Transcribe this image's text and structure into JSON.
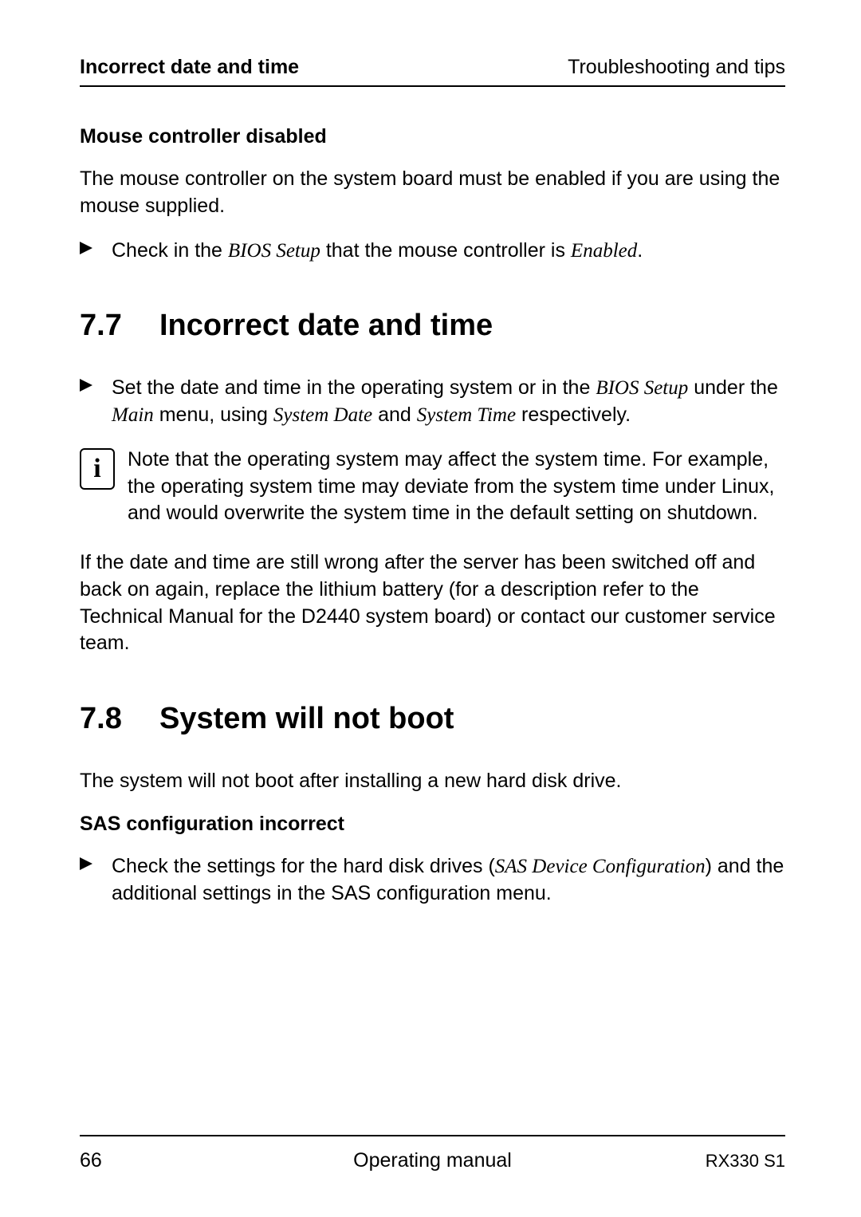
{
  "header": {
    "left": "Incorrect date and time",
    "right": "Troubleshooting and tips"
  },
  "mouse_section": {
    "title": "Mouse controller disabled",
    "intro": "The mouse controller on the system board must be enabled if you are using the mouse supplied.",
    "bullet_prefix": "Check in the ",
    "bullet_italic1": "BIOS Setup",
    "bullet_mid": " that the mouse controller is ",
    "bullet_italic2": "Enabled",
    "bullet_suffix": "."
  },
  "section_7_7": {
    "number": "7.7",
    "title": "Incorrect date and time",
    "bullet_p1": "Set the date and time in the operating system or in the ",
    "bullet_it1": "BIOS Setup",
    "bullet_p2": " under the ",
    "bullet_it2": "Main",
    "bullet_p3": " menu, using ",
    "bullet_it3": "System Date",
    "bullet_p4": " and ",
    "bullet_it4": "System Time",
    "bullet_p5": " respectively.",
    "info_glyph": "i",
    "info_text": "Note that the operating system may affect the system time. For example, the operating system time may deviate from the system time under Linux, and would overwrite the system time in the default setting on shutdown.",
    "after_para": "If the date and time are still wrong after the server has been switched off and back on again, replace the lithium battery (for a description refer to the Technical Manual for the D2440 system board) or contact our customer service team."
  },
  "section_7_8": {
    "number": "7.8",
    "title": "System will not boot",
    "intro": "The system will not boot after installing a new hard disk drive.",
    "subhead": "SAS configuration incorrect",
    "bullet_p1": "Check the settings for the hard disk drives (",
    "bullet_it1": "SAS Device Configuration",
    "bullet_p2": ") and the additional settings in the SAS configuration menu."
  },
  "footer": {
    "page": "66",
    "center": "Operating manual",
    "right": "RX330 S1"
  }
}
